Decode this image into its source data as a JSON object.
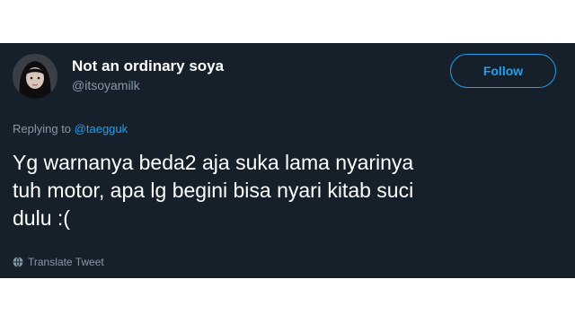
{
  "tweet": {
    "author_name": "Not an ordinary soya",
    "author_handle": "@itsoyamilk",
    "follow_label": "Follow",
    "replying_prefix": "Replying to",
    "replying_handle": "@taegguk",
    "text": "Yg warnanya beda2 aja suka lama nyarinya\ntuh motor, apa lg begini bisa nyari kitab suci\ndulu :(",
    "translate_label": "Translate Tweet",
    "avatar_icon": "avatar-photo",
    "translate_icon": "globe-icon"
  },
  "colors": {
    "background": "#15202b",
    "accent": "#1da1f2",
    "secondary_text": "#8899a6",
    "primary_text": "#ffffff"
  }
}
